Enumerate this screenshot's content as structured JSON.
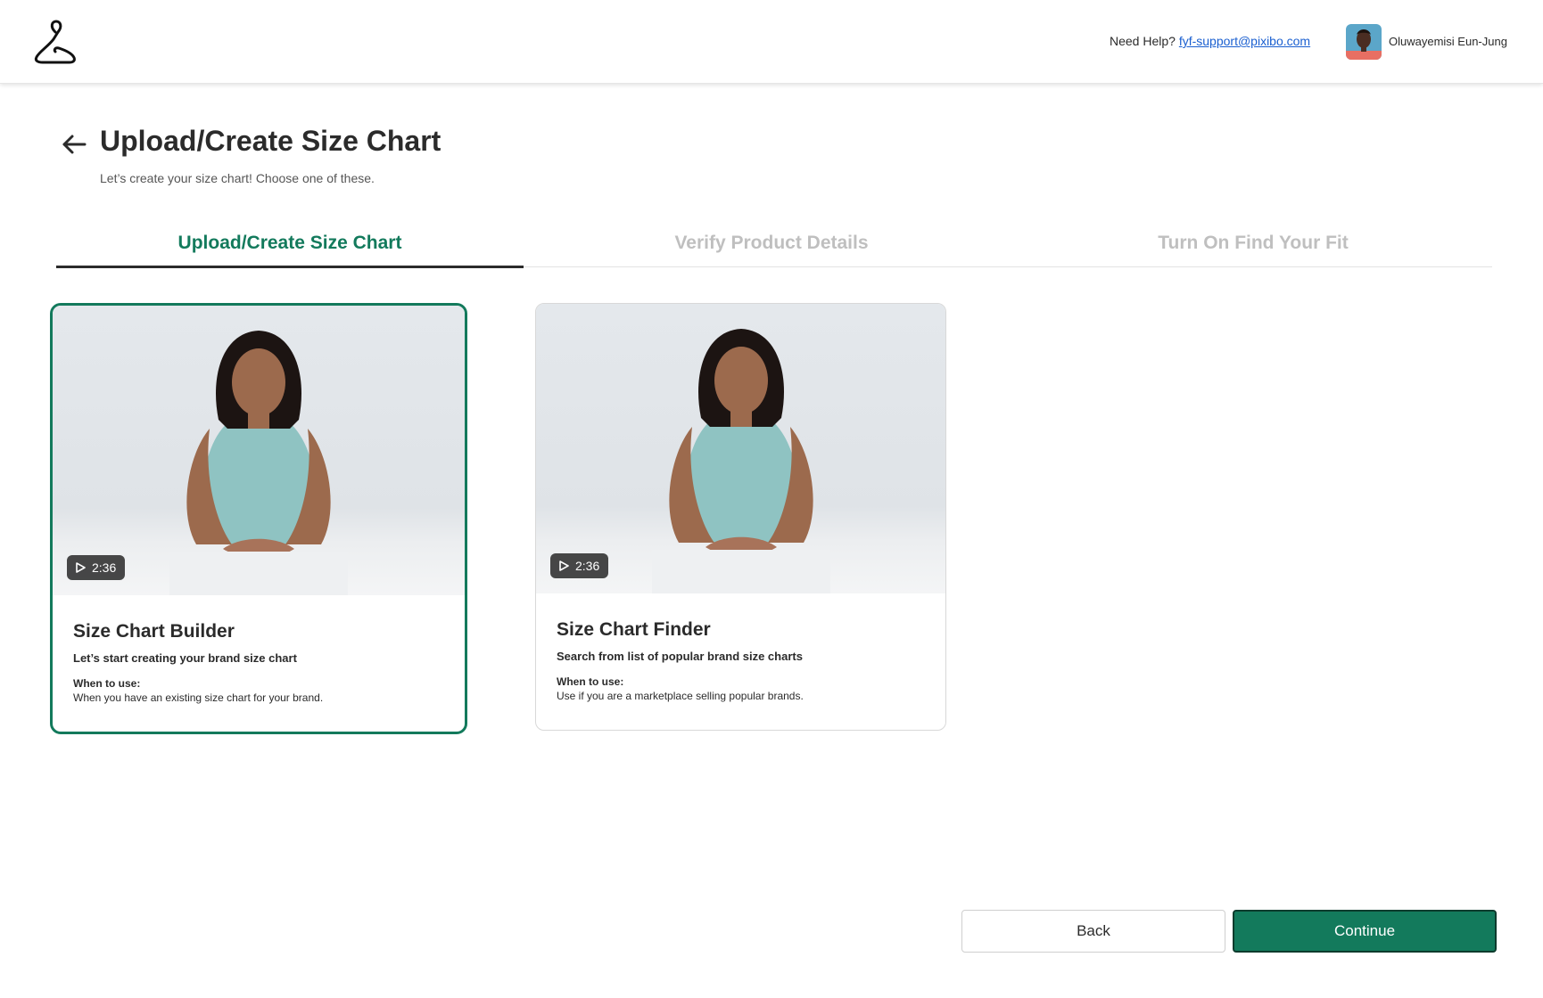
{
  "header": {
    "help_prefix": "Need Help?",
    "help_email": "fyf-support@pixibo.com",
    "user_name": "Oluwayemisi Eun-Jung"
  },
  "page": {
    "title": "Upload/Create Size Chart",
    "subtitle": "Let’s create your size chart! Choose one of these."
  },
  "steps": [
    {
      "label": "Upload/Create Size Chart",
      "active": true
    },
    {
      "label": "Verify Product Details",
      "active": false
    },
    {
      "label": "Turn On Find Your Fit",
      "active": false
    }
  ],
  "cards": [
    {
      "duration": "2:36",
      "title": "Size Chart Builder",
      "description": "Let’s start creating your brand size chart",
      "when_label": "When to use:",
      "when_text": "When you have an existing size chart for your brand.",
      "selected": true
    },
    {
      "duration": "2:36",
      "title": "Size Chart Finder",
      "description": "Search from list of popular brand size charts",
      "when_label": "When to use:",
      "when_text": "Use if you are a marketplace selling popular brands.",
      "selected": false
    }
  ],
  "actions": {
    "back_label": "Back",
    "continue_label": "Continue"
  },
  "colors": {
    "accent": "#137a5c",
    "link": "#1a5fd0",
    "inactive_tab": "#bfbfbf"
  },
  "icons": [
    "hanger-logo-icon",
    "back-arrow-icon",
    "play-icon"
  ]
}
